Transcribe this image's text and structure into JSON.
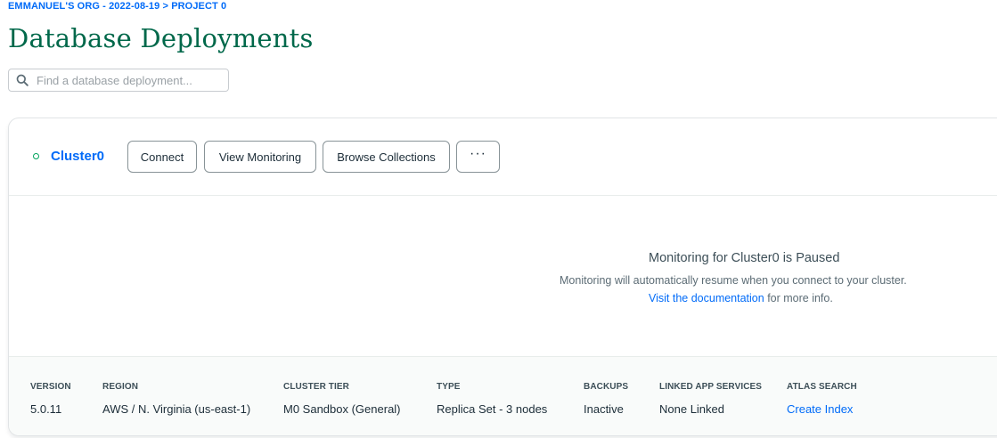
{
  "breadcrumb": "EMMANUEL'S ORG - 2022-08-19 > PROJECT 0",
  "page_title": "Database Deployments",
  "search": {
    "placeholder": "Find a database deployment..."
  },
  "colors": {
    "brand_green": "#00684a",
    "link_blue": "#016bf8",
    "status_green": "#00a35c"
  },
  "cluster": {
    "name": "Cluster0",
    "buttons": {
      "connect": "Connect",
      "view_monitoring": "View Monitoring",
      "browse_collections": "Browse Collections",
      "more": "···"
    },
    "monitoring": {
      "title": "Monitoring for Cluster0 is Paused",
      "description": "Monitoring will automatically resume when you connect to your cluster.",
      "docs_link": "Visit the documentation",
      "docs_suffix": " for more info."
    },
    "stats": [
      {
        "label": "VERSION",
        "value": "5.0.11"
      },
      {
        "label": "REGION",
        "value": "AWS / N. Virginia (us-east-1)"
      },
      {
        "label": "CLUSTER TIER",
        "value": "M0 Sandbox (General)"
      },
      {
        "label": "TYPE",
        "value": "Replica Set - 3 nodes"
      },
      {
        "label": "BACKUPS",
        "value": "Inactive"
      },
      {
        "label": "LINKED APP SERVICES",
        "value": "None Linked"
      },
      {
        "label": "ATLAS SEARCH",
        "value": "Create Index"
      }
    ]
  }
}
